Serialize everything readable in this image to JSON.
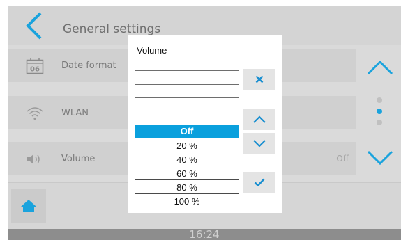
{
  "header": {
    "title": "General settings"
  },
  "rows": [
    {
      "label": "Date format",
      "icon": "calendar-icon",
      "icon_text": "06"
    },
    {
      "label": "WLAN",
      "icon": "wifi-icon"
    },
    {
      "label": "Volume",
      "icon": "speaker-icon",
      "value": "Off"
    }
  ],
  "footer": {
    "time": "16:24"
  },
  "dialog": {
    "title": "Volume",
    "options": [
      "Off",
      "20 %",
      "40 %",
      "60 %",
      "80 %",
      "100 %"
    ],
    "selected": "Off"
  },
  "colors": {
    "accent": "#0aa0dd",
    "screen_bg": "#dadada",
    "clockbar": "#8d8d8d"
  }
}
